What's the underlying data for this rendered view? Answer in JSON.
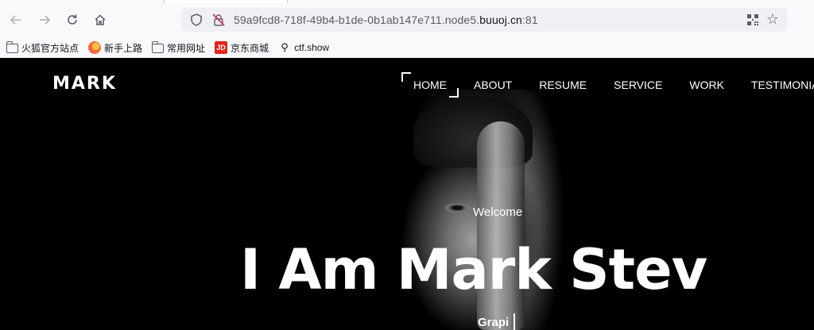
{
  "browser": {
    "nav": {
      "back_icon": "arrow-left-icon",
      "forward_icon": "arrow-right-icon",
      "reload_icon": "reload-icon",
      "home_icon": "home-icon"
    },
    "address_bar": {
      "url_prefix": "59a9fcd8-718f-49b4-b1de-0b1ab147e711.node5.",
      "url_domain": "buuoj.cn",
      "url_port": ":81",
      "shield_icon": "tracking-shield-icon",
      "lock_icon": "insecure-lock-icon",
      "qr_icon": "qr-code-icon",
      "star_icon": "bookmark-star-icon"
    },
    "bookmarks": [
      {
        "label": "火狐官方站点",
        "icon": "folder-icon"
      },
      {
        "label": "新手上路",
        "icon": "firefox-icon"
      },
      {
        "label": "常用网址",
        "icon": "folder-icon"
      },
      {
        "label": "京东商城",
        "icon": "jd-icon"
      },
      {
        "label": "ctf.show",
        "icon": "ctfshow-icon"
      }
    ]
  },
  "site": {
    "logo": "MARK",
    "menu": [
      "HOME",
      "ABOUT",
      "RESUME",
      "SERVICE",
      "WORK",
      "TESTIMONIAL"
    ],
    "active_menu": "HOME",
    "welcome": "Welcome",
    "headline": "I Am Mark Stev",
    "typing_text": "Grapi",
    "colors": {
      "background": "#000000",
      "text": "#ffffff",
      "chrome": "#f9f9fb",
      "urlbar": "#f0f0f4"
    }
  }
}
